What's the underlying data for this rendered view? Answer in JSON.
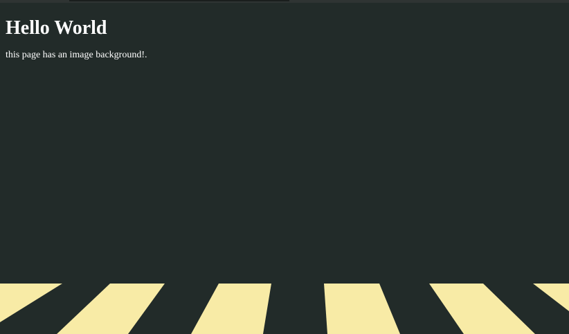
{
  "page": {
    "heading": "Hello World",
    "paragraph": "this page has an image background!."
  },
  "colors": {
    "background": "#222b29",
    "text": "#ffffff",
    "stripe": "#f8eba6"
  }
}
